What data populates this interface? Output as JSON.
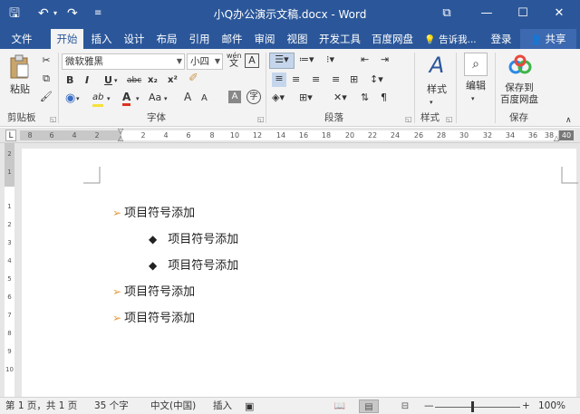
{
  "window": {
    "title": "小Q办公演示文稿.docx - Word",
    "icons": [
      "save-icon",
      "undo-icon",
      "redo-icon",
      "customize-qat-icon",
      "ribbon-display-icon",
      "minimize-icon",
      "maximize-icon",
      "close-icon"
    ],
    "qa": {
      "save": "🖫",
      "undo": "↶",
      "undo_arrow": "▾",
      "redo": "↷",
      "customize": "≡"
    },
    "controls": {
      "ribbon_display": "⧉",
      "minimize": "—",
      "maximize": "☐",
      "close": "✕"
    }
  },
  "tabs": [
    {
      "label": "文件"
    },
    {
      "label": "开始"
    },
    {
      "label": "插入"
    },
    {
      "label": "设计"
    },
    {
      "label": "布局"
    },
    {
      "label": "引用"
    },
    {
      "label": "邮件"
    },
    {
      "label": "审阅"
    },
    {
      "label": "视图"
    },
    {
      "label": "开发工具"
    },
    {
      "label": "百度网盘"
    }
  ],
  "tell_me": {
    "icon": "lightbulb-icon",
    "glyph": "💡",
    "label": "告诉我..."
  },
  "login": {
    "label": "登录"
  },
  "share": {
    "icon": "person-icon",
    "glyph": "👤",
    "label": "共享"
  },
  "ribbon": {
    "clipboard": {
      "paste": "粘贴",
      "group": "剪贴板"
    },
    "font": {
      "name": "微软雅黑",
      "size": "小四",
      "group": "字体",
      "bold": "B",
      "italic": "I",
      "underline": "U",
      "strike": "abc",
      "subscript": "x₂",
      "superscript": "x²",
      "font_color": "A",
      "highlight": "ab",
      "case": "Aa",
      "grow": "A",
      "shrink": "A",
      "clear": "A",
      "shade": "A",
      "enclose": "字",
      "phonetic": "wén",
      "phonetic_char": "文",
      "border_char": "A"
    },
    "paragraph": {
      "group": "段落"
    },
    "styles": {
      "label": "样式",
      "group": "样式"
    },
    "editing": {
      "label": "编辑"
    },
    "save_cloud": {
      "label_line1": "保存到",
      "label_line2": "百度网盘",
      "group": "保存"
    }
  },
  "ruler": {
    "corner": "L",
    "horizontal": [
      "8",
      "6",
      "4",
      "2",
      "2",
      "4",
      "6",
      "8",
      "10",
      "12",
      "14",
      "16",
      "18",
      "20",
      "22",
      "24",
      "26",
      "28",
      "30",
      "32",
      "34",
      "36",
      "38",
      "40"
    ],
    "vertical": [
      "2",
      "1",
      "1",
      "2",
      "3",
      "4",
      "5",
      "6",
      "7",
      "8",
      "9",
      "10"
    ]
  },
  "document": {
    "lines": [
      {
        "bullet": "arrow",
        "text": "项目符号添加",
        "level": 0
      },
      {
        "bullet": "diamond",
        "text": "项目符号添加",
        "level": 1
      },
      {
        "bullet": "diamond",
        "text": "项目符号添加",
        "level": 1
      },
      {
        "bullet": "arrow",
        "text": "项目符号添加",
        "level": 0
      },
      {
        "bullet": "arrow",
        "text": "项目符号添加",
        "level": 0
      }
    ],
    "bullet_arrow_glyph": "➢",
    "bullet_diamond_glyph": "◆"
  },
  "status": {
    "page": "第 1 页，共 1 页",
    "words": "35 个字",
    "language": "中文(中国)",
    "mode": "插入",
    "zoom": "100%",
    "zoom_minus": "—",
    "zoom_plus": "+",
    "views": {
      "read": "📖",
      "print": "▤",
      "web": "⊟"
    }
  }
}
